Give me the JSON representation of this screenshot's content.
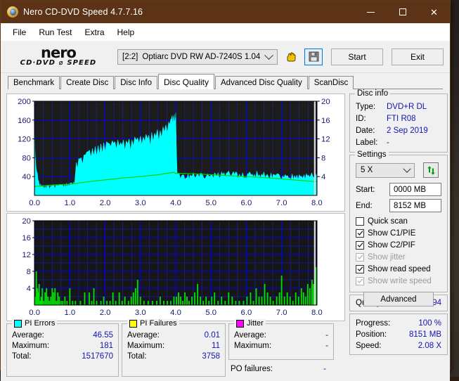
{
  "window": {
    "title": "Nero CD-DVD Speed 4.7.7.16",
    "icon": "disc-icon",
    "minimize": "–",
    "maximize": "□",
    "close": "✕"
  },
  "menu": {
    "items": [
      "File",
      "Run Test",
      "Extra",
      "Help"
    ]
  },
  "toolbar": {
    "logo_line1": "nero",
    "logo_line2": "CD·DVD ⌀ SPEED",
    "drive_bracket": "[2:2]",
    "drive_name": "Optiarc DVD RW AD-7240S 1.04",
    "icon_hand": "hand-icon",
    "icon_save": "save-icon",
    "start_label": "Start",
    "exit_label": "Exit"
  },
  "tabs": {
    "items": [
      "Benchmark",
      "Create Disc",
      "Disc Info",
      "Disc Quality",
      "Advanced Disc Quality",
      "ScanDisc"
    ],
    "active": "Disc Quality"
  },
  "disc_info": {
    "legend": "Disc info",
    "rows": [
      {
        "key": "Type:",
        "value": "DVD+R DL"
      },
      {
        "key": "ID:",
        "value": "FTI R08"
      },
      {
        "key": "Date:",
        "value": "2 Sep 2019"
      },
      {
        "key": "Label:",
        "value": "-"
      }
    ]
  },
  "settings": {
    "legend": "Settings",
    "speed_value": "5 X",
    "refresh_icon": "refresh-icon",
    "start_label": "Start:",
    "start_value": "0000 MB",
    "end_label": "End:",
    "end_value": "8152 MB",
    "checkboxes": [
      {
        "label": "Quick scan",
        "checked": false,
        "disabled": false
      },
      {
        "label": "Show C1/PIE",
        "checked": true,
        "disabled": false
      },
      {
        "label": "Show C2/PIF",
        "checked": true,
        "disabled": false
      },
      {
        "label": "Show jitter",
        "checked": true,
        "disabled": true
      },
      {
        "label": "Show read speed",
        "checked": true,
        "disabled": false
      },
      {
        "label": "Show write speed",
        "checked": true,
        "disabled": true
      }
    ],
    "advanced_label": "Advanced"
  },
  "quality": {
    "label": "Quality score:",
    "value": "94"
  },
  "progress": {
    "rows": [
      {
        "key": "Progress:",
        "value": "100 %"
      },
      {
        "key": "Position:",
        "value": "8151 MB"
      },
      {
        "key": "Speed:",
        "value": "2.08 X"
      }
    ]
  },
  "stats": {
    "pi_errors": {
      "legend": "PI Errors",
      "color": "#00ffff",
      "rows": [
        {
          "key": "Average:",
          "value": "46.55"
        },
        {
          "key": "Maximum:",
          "value": "181"
        },
        {
          "key": "Total:",
          "value": "1517670"
        }
      ]
    },
    "pi_failures": {
      "legend": "PI Failures",
      "color": "#ffff00",
      "rows": [
        {
          "key": "Average:",
          "value": "0.01"
        },
        {
          "key": "Maximum:",
          "value": "11"
        },
        {
          "key": "Total:",
          "value": "3758"
        }
      ]
    },
    "jitter": {
      "legend": "Jitter",
      "color": "#ff00ff",
      "rows": [
        {
          "key": "Average:",
          "value": "-"
        },
        {
          "key": "Maximum:",
          "value": "-"
        }
      ],
      "po_key": "PO failures:",
      "po_value": "-"
    }
  },
  "chart_data": [
    {
      "type": "area",
      "name": "pi-errors-chart",
      "title": "",
      "xlabel": "",
      "ylabel": "",
      "bg": "#1c1c1c",
      "grid": true,
      "grid_color": "#0000ff",
      "xlim": [
        0,
        8
      ],
      "ylim": [
        0,
        200
      ],
      "y2lim": [
        0,
        20
      ],
      "xticks": [
        "0.0",
        "1.0",
        "2.0",
        "3.0",
        "4.0",
        "5.0",
        "6.0",
        "7.0",
        "8.0"
      ],
      "yticks": [
        "200",
        "160",
        "120",
        "80",
        "40"
      ],
      "y2ticks": [
        "20",
        "16",
        "12",
        "8",
        "4"
      ],
      "series": [
        {
          "name": "PI Errors",
          "color": "#00ffff",
          "style": "area",
          "x": [
            0.0,
            0.04,
            0.08,
            0.12,
            0.16,
            0.2,
            0.25,
            0.3,
            0.35,
            0.4,
            0.45,
            0.5,
            0.55,
            0.6,
            0.65,
            0.7,
            0.75,
            0.8,
            0.85,
            0.9,
            0.95,
            1.0,
            1.05,
            1.1,
            1.14,
            1.18,
            1.25,
            1.32,
            1.4,
            1.48,
            1.56,
            1.64,
            1.72,
            1.8,
            1.88,
            1.96,
            2.04,
            2.12,
            2.2,
            2.28,
            2.36,
            2.44,
            2.52,
            2.6,
            2.68,
            2.76,
            2.84,
            2.92,
            3.0,
            3.08,
            3.16,
            3.24,
            3.32,
            3.4,
            3.48,
            3.56,
            3.64,
            3.72,
            3.8,
            3.86,
            3.9,
            3.93,
            3.96,
            3.99,
            4.0,
            4.04,
            4.1,
            4.2,
            4.35,
            4.5,
            4.7,
            4.9,
            5.1,
            5.3,
            5.5,
            5.7,
            5.9,
            6.1,
            6.3,
            6.5,
            6.7,
            6.9,
            7.1,
            7.3,
            7.5,
            7.7,
            7.85,
            7.95,
            8.0
          ],
          "y": [
            135,
            62,
            48,
            30,
            25,
            22,
            21,
            20,
            22,
            21,
            20,
            22,
            23,
            21,
            22,
            24,
            23,
            22,
            24,
            26,
            25,
            26,
            27,
            28,
            30,
            70,
            78,
            80,
            86,
            92,
            96,
            100,
            104,
            106,
            110,
            112,
            114,
            110,
            116,
            114,
            118,
            112,
            118,
            116,
            120,
            118,
            124,
            122,
            126,
            124,
            130,
            128,
            134,
            132,
            140,
            138,
            146,
            150,
            156,
            162,
            170,
            168,
            172,
            166,
            176,
            48,
            46,
            44,
            46,
            48,
            47,
            46,
            48,
            50,
            52,
            50,
            48,
            50,
            52,
            50,
            48,
            46,
            44,
            46,
            44,
            46,
            48,
            50,
            46
          ]
        },
        {
          "name": "Read speed",
          "color": "#00d000",
          "style": "line",
          "x": [
            0.0,
            0.5,
            1.0,
            1.14,
            1.5,
            2.0,
            2.5,
            3.0,
            3.5,
            3.95,
            4.0,
            4.5,
            5.0,
            5.5,
            6.0,
            6.5,
            7.0,
            7.5,
            8.0
          ],
          "y2": [
            1.9,
            2.2,
            2.4,
            2.5,
            2.9,
            3.3,
            3.7,
            4.0,
            4.4,
            4.9,
            4.7,
            4.6,
            4.4,
            4.2,
            4.0,
            3.8,
            3.5,
            3.2,
            2.9
          ]
        }
      ]
    },
    {
      "type": "bar",
      "name": "pi-failures-chart",
      "title": "",
      "xlabel": "",
      "ylabel": "",
      "bg": "#161616",
      "grid": true,
      "grid_color": "#0000ff",
      "xlim": [
        0,
        8
      ],
      "ylim": [
        0,
        20
      ],
      "xticks": [
        "0.0",
        "1.0",
        "2.0",
        "3.0",
        "4.0",
        "5.0",
        "6.0",
        "7.0",
        "8.0"
      ],
      "yticks": [
        "20",
        "16",
        "12",
        "8",
        "4"
      ],
      "series": [
        {
          "name": "PI Failures",
          "color": "#00e000",
          "x": [
            0.02,
            0.05,
            0.08,
            0.1,
            0.13,
            0.16,
            0.19,
            0.22,
            0.26,
            0.3,
            0.34,
            0.38,
            0.42,
            0.46,
            0.5,
            0.54,
            0.58,
            0.62,
            0.66,
            0.7,
            0.75,
            0.8,
            0.86,
            0.92,
            1.0,
            1.08,
            1.16,
            1.3,
            1.42,
            1.55,
            1.62,
            1.68,
            1.76,
            1.88,
            1.96,
            2.05,
            2.14,
            2.22,
            2.3,
            2.4,
            2.48,
            2.56,
            2.66,
            2.74,
            2.8,
            2.86,
            2.92,
            3.0,
            3.1,
            3.22,
            3.34,
            3.46,
            3.56,
            3.66,
            3.76,
            3.86,
            3.95,
            4.02,
            4.08,
            4.14,
            4.2,
            4.26,
            4.32,
            4.38,
            4.46,
            4.54,
            4.62,
            4.7,
            4.78,
            4.86,
            4.94,
            5.02,
            5.1,
            5.2,
            5.3,
            5.4,
            5.5,
            5.6,
            5.7,
            5.8,
            5.92,
            6.02,
            6.12,
            6.2,
            6.28,
            6.36,
            6.44,
            6.52,
            6.6,
            6.68,
            6.76,
            6.86,
            6.94,
            7.0,
            7.08,
            7.16,
            7.24,
            7.32,
            7.4,
            7.48,
            7.56,
            7.62,
            7.68,
            7.74,
            7.8,
            7.86,
            7.9,
            7.94,
            7.97
          ],
          "y": [
            2,
            8,
            4,
            3,
            5,
            1,
            2,
            4,
            1,
            3,
            4,
            2,
            1,
            2,
            4,
            3,
            4,
            1,
            3,
            2,
            1,
            1,
            2,
            1,
            4,
            1,
            1,
            1,
            3,
            3,
            1,
            4,
            1,
            1,
            2,
            1,
            1,
            3,
            1,
            3,
            1,
            2,
            1,
            2,
            3,
            4,
            6,
            2,
            1,
            1,
            1,
            1,
            2,
            1,
            1,
            1,
            2,
            2,
            3,
            2,
            1,
            3,
            2,
            1,
            2,
            3,
            5,
            2,
            1,
            2,
            1,
            2,
            3,
            1,
            2,
            1,
            3,
            2,
            1,
            1,
            1,
            2,
            3,
            1,
            4,
            2,
            2,
            5,
            3,
            2,
            1,
            2,
            3,
            7,
            2,
            3,
            2,
            1,
            3,
            2,
            4,
            3,
            2,
            5,
            4,
            6,
            5,
            3,
            9
          ]
        }
      ]
    }
  ]
}
